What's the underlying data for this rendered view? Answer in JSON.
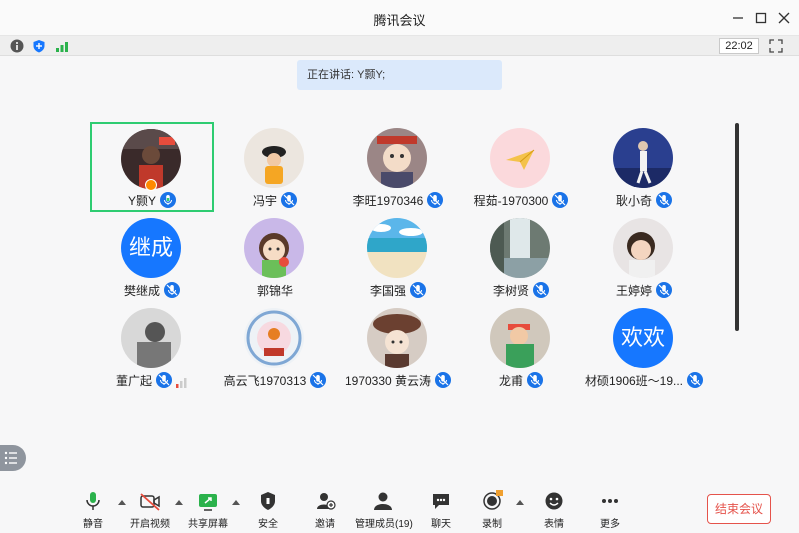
{
  "window": {
    "title": "腾讯会议"
  },
  "infobar": {
    "time": "22:02"
  },
  "speaking": {
    "text": "正在讲话: Y颢Y;"
  },
  "participants": [
    {
      "name": "Y颢Y"
    },
    {
      "name": "冯宇"
    },
    {
      "name": "李旺1970346"
    },
    {
      "name": "程茹-1970300"
    },
    {
      "name": "耿小奇"
    },
    {
      "name": "樊继成",
      "avatar_text": "继成"
    },
    {
      "name": "郭锦华"
    },
    {
      "name": "李国强"
    },
    {
      "name": "李树贤"
    },
    {
      "name": "王婷婷"
    },
    {
      "name": "董广起"
    },
    {
      "name": "高云飞1970313"
    },
    {
      "name": "1970330  黄云涛"
    },
    {
      "name": "龙甫"
    },
    {
      "name": "材硕1906班～19...",
      "avatar_text": "欢欢"
    }
  ],
  "toolbar": {
    "mute": "静音",
    "video": "开启视频",
    "share": "共享屏幕",
    "security": "安全",
    "invite": "邀请",
    "members": "管理成员(19)",
    "chat": "聊天",
    "record": "录制",
    "emoji": "表情",
    "more": "更多"
  },
  "end_button": "结束会议",
  "colors": {
    "accent": "#1677ff",
    "speaker_border": "#2ecc71",
    "end": "#e5534b"
  }
}
